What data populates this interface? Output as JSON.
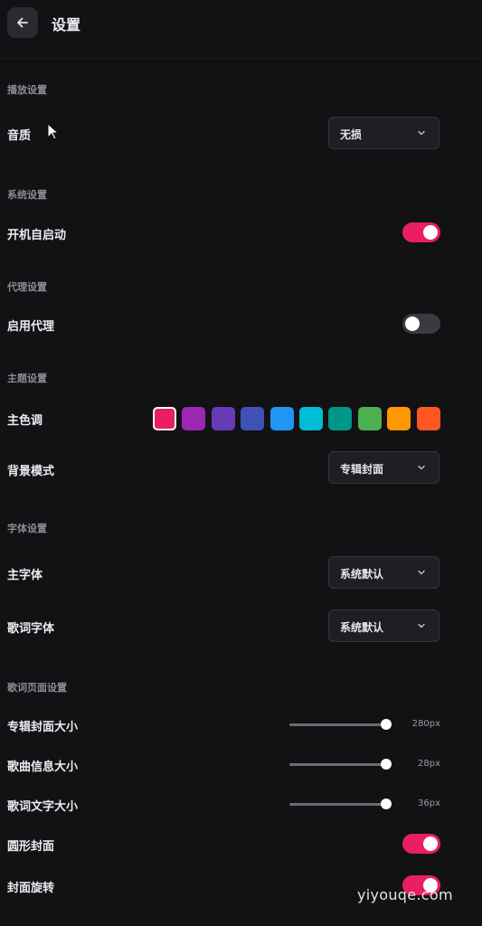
{
  "header": {
    "title": "设置",
    "back_icon": "arrow-left-icon"
  },
  "sections": {
    "playback": {
      "title": "播放设置",
      "quality_label": "音质",
      "quality_value": "无损"
    },
    "system": {
      "title": "系统设置",
      "autostart_label": "开机自启动",
      "autostart_on": true
    },
    "proxy": {
      "title": "代理设置",
      "enable_label": "启用代理",
      "enable_on": false
    },
    "theme": {
      "title": "主题设置",
      "color_label": "主色调",
      "colors": [
        "#e91e63",
        "#9c27b0",
        "#673ab7",
        "#3f51b5",
        "#2196f3",
        "#00bcd4",
        "#009688",
        "#4caf50",
        "#ff9800",
        "#ff5722"
      ],
      "selected_color": "#e91e63",
      "bg_label": "背景模式",
      "bg_value": "专辑封面"
    },
    "font": {
      "title": "字体设置",
      "main_label": "主字体",
      "main_value": "系统默认",
      "lyric_label": "歌词字体",
      "lyric_value": "系统默认"
    },
    "lyrics_page": {
      "title": "歌词页面设置",
      "cover_size_label": "专辑封面大小",
      "cover_size_value": "280px",
      "cover_size_level": 1.0,
      "info_size_label": "歌曲信息大小",
      "info_size_value": "28px",
      "info_size_level": 1.0,
      "text_size_label": "歌词文字大小",
      "text_size_value": "36px",
      "text_size_level": 1.0,
      "round_cover_label": "圆形封面",
      "round_cover_on": true,
      "cover_rotate_label": "封面旋转",
      "cover_rotate_on": true
    }
  },
  "watermark": "yiyouqe.com",
  "colors": {
    "accent": "#e91e63",
    "background": "#121215",
    "toggle_off": "#3a3a40"
  }
}
